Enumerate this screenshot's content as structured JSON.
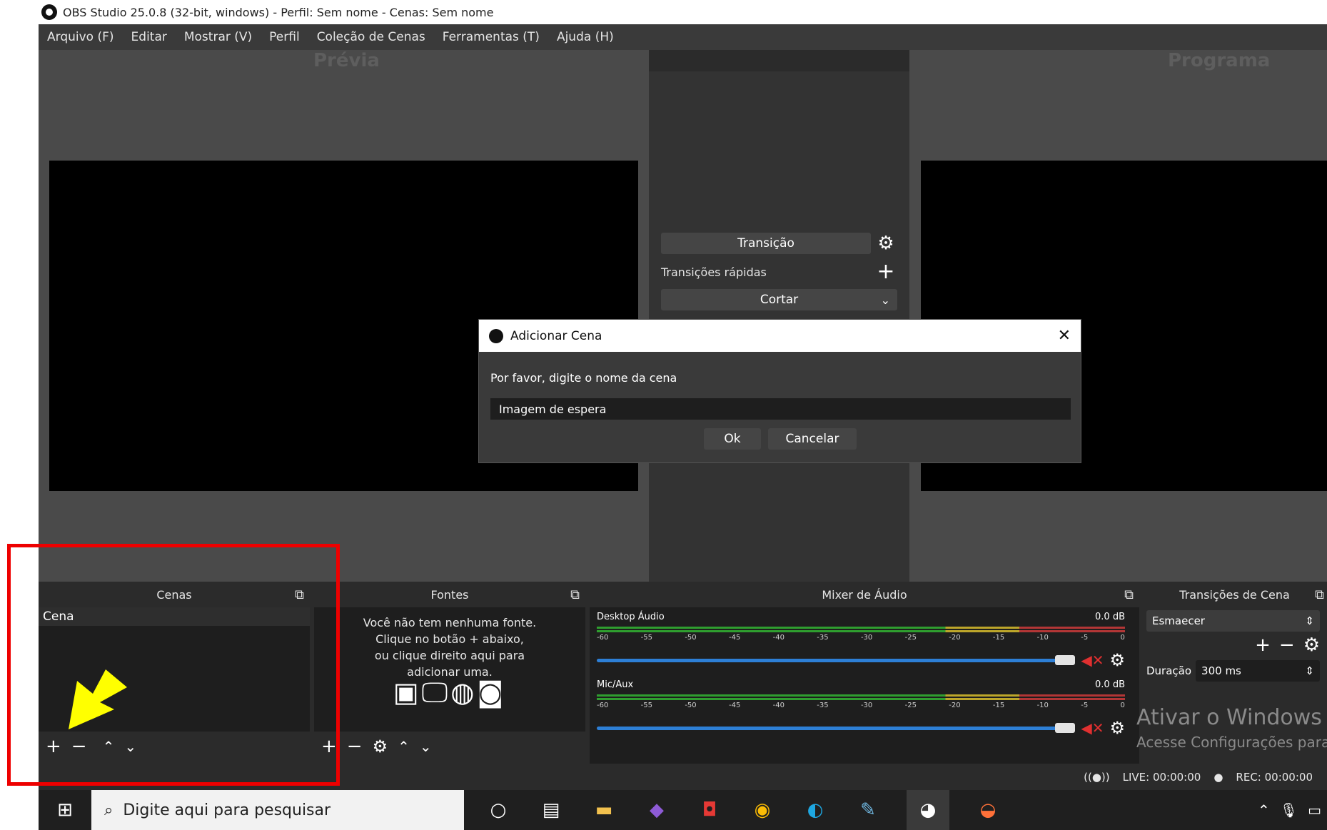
{
  "window": {
    "title": "OBS Studio 25.0.8 (32-bit, windows) - Perfil: Sem nome - Cenas: Sem nome"
  },
  "menu": [
    "Arquivo (F)",
    "Editar",
    "Mostrar (V)",
    "Perfil",
    "Coleção de Cenas",
    "Ferramentas (T)",
    "Ajuda (H)"
  ],
  "preview": {
    "label": "Prévia"
  },
  "program": {
    "label": "Programa"
  },
  "transition": {
    "button": "Transição",
    "quick_label": "Transições rápidas",
    "cut": "Cortar"
  },
  "dialog": {
    "title": "Adicionar Cena",
    "prompt": "Por favor, digite o nome da cena",
    "value": "Imagem de espera",
    "ok": "Ok",
    "cancel": "Cancelar"
  },
  "scenes": {
    "title": "Cenas",
    "items": [
      "Cena"
    ]
  },
  "sources": {
    "title": "Fontes",
    "empty_lines": [
      "Você não tem nenhuma fonte.",
      "Clique no botão + abaixo,",
      "ou clique direito aqui para",
      "adicionar uma."
    ]
  },
  "mixer": {
    "title": "Mixer de Áudio",
    "tracks": [
      {
        "name": "Desktop Áudio",
        "db": "0.0 dB"
      },
      {
        "name": "Mic/Aux",
        "db": "0.0 dB"
      }
    ],
    "ticks": [
      "-60",
      "-55",
      "-50",
      "-45",
      "-40",
      "-35",
      "-30",
      "-25",
      "-20",
      "-15",
      "-10",
      "-5",
      "0"
    ]
  },
  "scene_transitions": {
    "title": "Transições de Cena",
    "selected": "Esmaecer",
    "duration_label": "Duração",
    "duration_value": "300 ms"
  },
  "watermark": {
    "line1": "Ativar o Windows",
    "line2": "Acesse Configurações para"
  },
  "status": {
    "live": "LIVE: 00:00:00",
    "rec": "REC: 00:00:00"
  },
  "taskbar": {
    "search_placeholder": "Digite aqui para pesquisar"
  },
  "colors": {
    "highlight": "#e00000",
    "arrow": "#ffff00",
    "slider": "#2d7fd6",
    "mute": "#e03030"
  }
}
